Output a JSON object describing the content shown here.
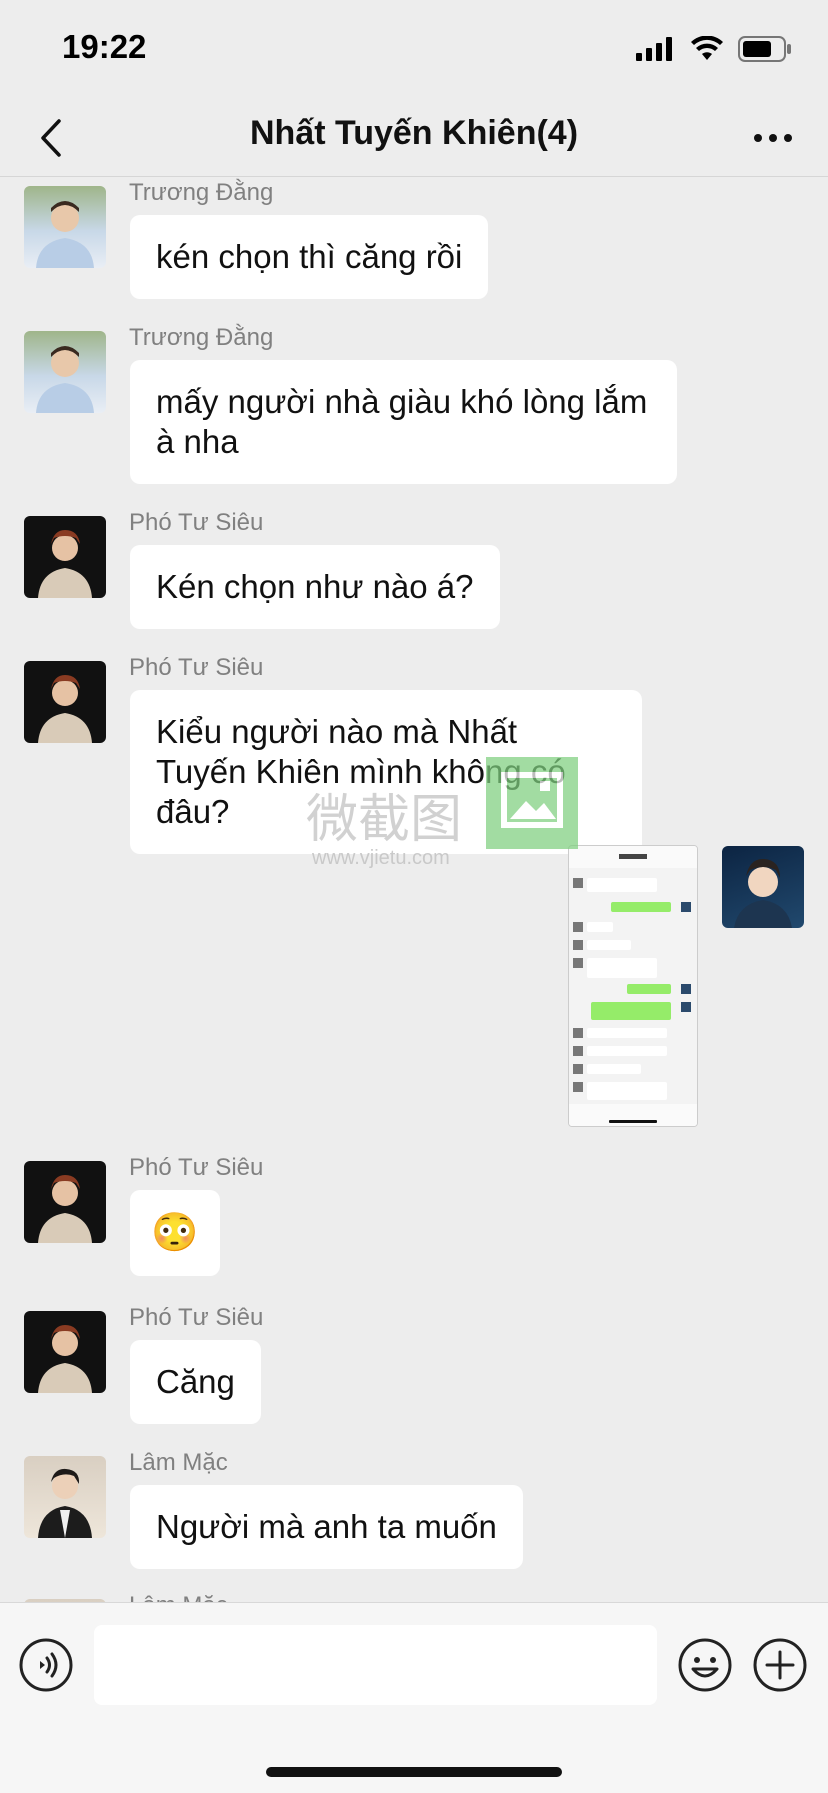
{
  "status_bar": {
    "time": "19:22"
  },
  "header": {
    "title": "Nhất Tuyến Khiên(4)",
    "back_icon": "chevron-left-icon",
    "more_icon": "more-horizontal-icon"
  },
  "messages": [
    {
      "sender": "Trương Đằng",
      "text": "kén chọn thì căng rồi",
      "avatar": "avatar-truong-dang"
    },
    {
      "sender": "Trương Đằng",
      "text": "mấy người nhà giàu khó lòng lắm à nha",
      "avatar": "avatar-truong-dang"
    },
    {
      "sender": "Phó Tư Siêu",
      "text": "Kén chọn như nào á?",
      "avatar": "avatar-pho-tu-sieu"
    },
    {
      "sender": "Phó Tư Siêu",
      "text": "Kiểu người nào mà Nhất Tuyến Khiên mình không có đâu?",
      "avatar": "avatar-pho-tu-sieu"
    },
    {
      "sender": "me",
      "type": "image",
      "avatar": "avatar-self"
    },
    {
      "sender": "Phó Tư Siêu",
      "text": "😳",
      "avatar": "avatar-pho-tu-sieu"
    },
    {
      "sender": "Phó Tư Siêu",
      "text": "Căng",
      "avatar": "avatar-pho-tu-sieu"
    },
    {
      "sender": "Lâm Mặc",
      "text": "Người mà anh ta muốn",
      "avatar": "avatar-lam-mac"
    },
    {
      "sender": "Lâm Mặc",
      "text": "",
      "avatar": "avatar-lam-mac"
    }
  ],
  "watermark": {
    "brand": "微截图",
    "url": "www.vjietu.com"
  },
  "input_bar": {
    "voice_icon": "voice-icon",
    "emoji_icon": "smiley-icon",
    "plus_icon": "plus-circle-icon",
    "placeholder": ""
  },
  "colors": {
    "background": "#ededed",
    "bubble_in": "#ffffff",
    "bubble_out": "#95ec69",
    "text": "#111111"
  }
}
